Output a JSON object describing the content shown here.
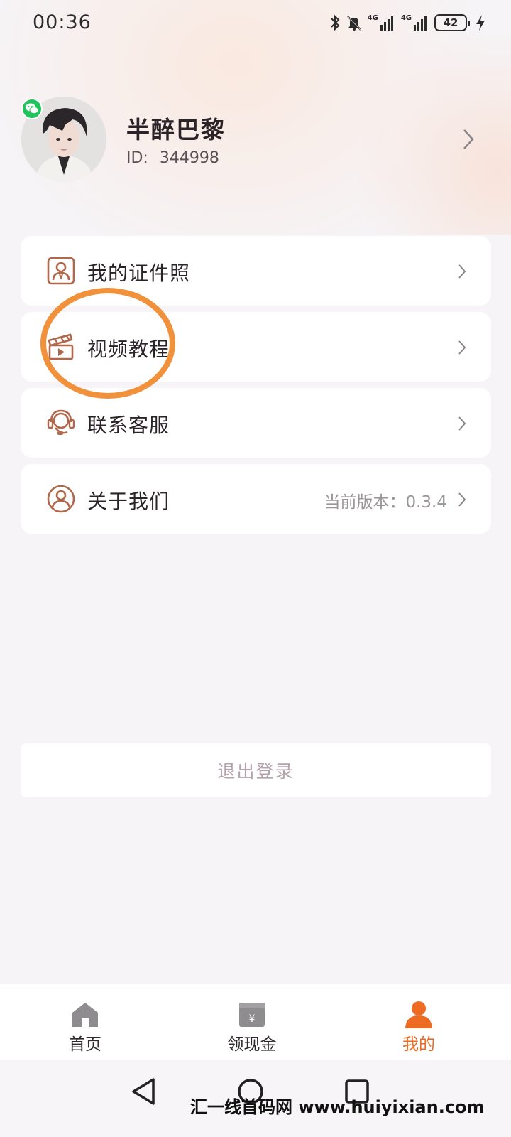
{
  "status_bar": {
    "time": "00:36",
    "battery_level": "42",
    "network_1": "4G",
    "network_2": "4G",
    "icons": [
      "bluetooth-icon",
      "bell-muted-icon",
      "signal-4g-icon",
      "signal-4g-icon",
      "battery-icon",
      "charging-bolt-icon"
    ]
  },
  "profile": {
    "username": "半醉巴黎",
    "id_label": "ID:",
    "id_value": "344998",
    "badge_icon": "wechat-icon"
  },
  "menu": {
    "items": [
      {
        "label": "我的证件照",
        "icon": "id-photo-icon"
      },
      {
        "label": "视频教程",
        "icon": "video-clapper-icon"
      },
      {
        "label": "联系客服",
        "icon": "headset-icon"
      },
      {
        "label": "关于我们",
        "icon": "user-circle-icon",
        "extra": "当前版本：0.3.4"
      }
    ]
  },
  "logout_label": "退出登录",
  "tabs": [
    {
      "label": "首页",
      "icon": "home-icon",
      "active": false
    },
    {
      "label": "领现金",
      "icon": "cash-wallet-icon",
      "active": false
    },
    {
      "label": "我的",
      "icon": "profile-person-icon",
      "active": true
    }
  ],
  "watermark": "汇一线首码网 www.huiyixian.com",
  "colors": {
    "accent": "#ed6b22",
    "icon_brown": "#b0674a",
    "highlight_circle": "#f2913c",
    "background": "#f6f4f7"
  }
}
